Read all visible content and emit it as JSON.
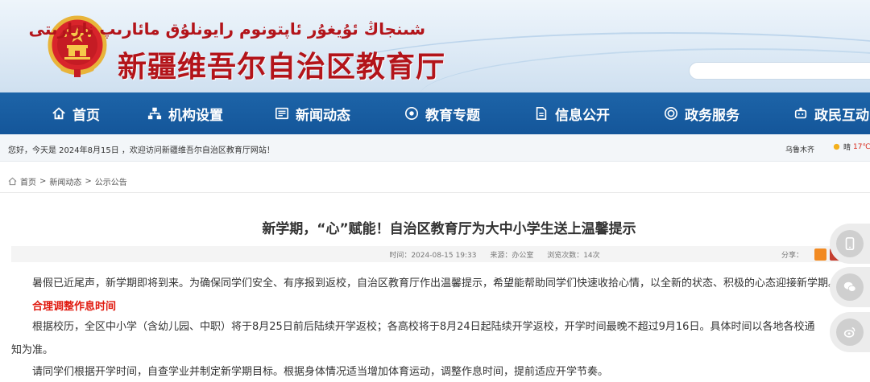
{
  "header": {
    "uyghur_title": "شىنجاڭ ئۇيغۇر ئاپتونوم رايونلۇق مائارىپ نازارىتى",
    "site_title": "新疆维吾尔自治区教育厅"
  },
  "nav": {
    "items": [
      {
        "label": "首页",
        "icon": "home-icon"
      },
      {
        "label": "机构设置",
        "icon": "org-chart-icon"
      },
      {
        "label": "新闻动态",
        "icon": "news-icon"
      },
      {
        "label": "教育专题",
        "icon": "topic-icon"
      },
      {
        "label": "信息公开",
        "icon": "document-icon"
      },
      {
        "label": "政务服务",
        "icon": "service-icon"
      },
      {
        "label": "政民互动",
        "icon": "interaction-icon"
      }
    ]
  },
  "notice": {
    "greeting": "您好，今天是 2024年8月15日 ，欢迎访问新疆维吾尔自治区教育厅网站！",
    "city": "乌鲁木齐",
    "weather": "晴",
    "temperature": "17℃",
    "temperature_suffix": "~"
  },
  "breadcrumb": {
    "items": [
      "首页",
      "新闻动态",
      "公示公告"
    ],
    "separator": ">"
  },
  "article": {
    "title": "新学期，“心”赋能！自治区教育厅为大中小学生送上温馨提示",
    "time": "时间：2024-08-15 19:33",
    "source": "来源：办公室",
    "views": "浏览次数：14次",
    "share_label": "分享：",
    "para1": "暑假已近尾声，新学期即将到来。为确保同学们安全、有序报到返校，自治区教育厅作出温馨提示，希望能帮助同学们快速收拾心情，以全新的状态、积极的心态迎接新学期。",
    "subhead1": "合理调整作息时间",
    "para2": "根据校历，全区中小学（含幼儿园、中职）将于8月25日前后陆续开学返校；各高校将于8月24日起陆续开学返校，开学时间最晚不超过9月16日。具体时间以各地各校通",
    "para2_cont": "知为准。",
    "para3": "请同学们根据开学时间，自查学业并制定新学期目标。根据身体情况适当增加体育运动，调整作息时间，提前适应开学节奏。"
  },
  "colors": {
    "nav_bg": "#1a5fa3",
    "title_red": "#b3141a",
    "subhead_red": "#e0190e"
  }
}
